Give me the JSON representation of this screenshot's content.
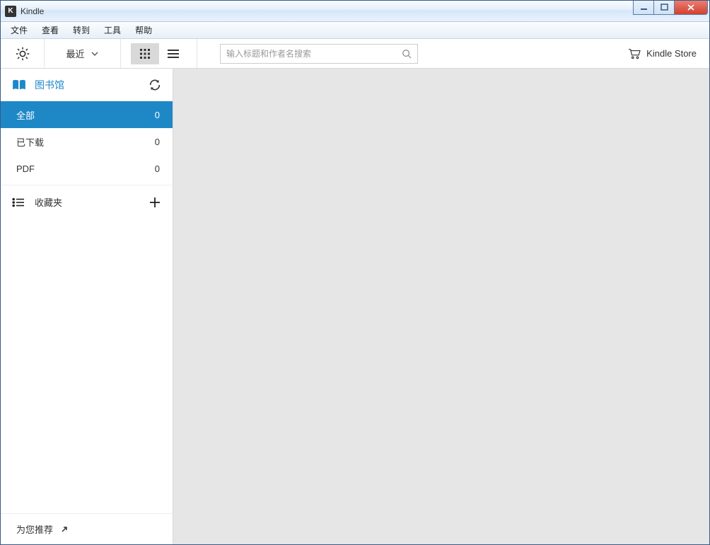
{
  "window": {
    "title": "Kindle"
  },
  "menubar": [
    "文件",
    "查看",
    "转到",
    "工具",
    "帮助"
  ],
  "toolbar": {
    "sort_label": "最近",
    "search_placeholder": "输入标题和作者名搜索",
    "store_label": "Kindle Store"
  },
  "sidebar": {
    "library_label": "图书馆",
    "filters": [
      {
        "label": "全部",
        "count": 0,
        "active": true
      },
      {
        "label": "已下载",
        "count": 0,
        "active": false
      },
      {
        "label": "PDF",
        "count": 0,
        "active": false
      }
    ],
    "collections_label": "收藏夹",
    "footer_label": "为您推荐"
  }
}
